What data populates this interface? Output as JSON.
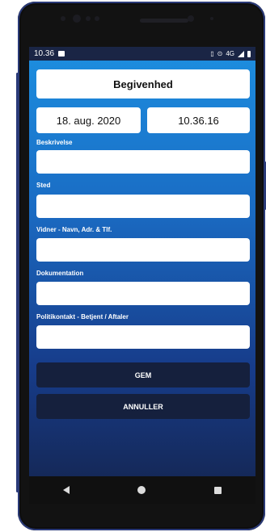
{
  "status_bar": {
    "time": "10.36",
    "network": "4G"
  },
  "header": {
    "title": "Begivenhed"
  },
  "datetime": {
    "date": "18. aug. 2020",
    "time": "10.36.16"
  },
  "fields": [
    {
      "label": "Beskrivelse",
      "value": ""
    },
    {
      "label": "Sted",
      "value": ""
    },
    {
      "label": "Vidner - Navn, Adr. & Tlf.",
      "value": ""
    },
    {
      "label": "Dokumentation",
      "value": ""
    },
    {
      "label": "Politikontakt - Betjent / Aftaler",
      "value": ""
    }
  ],
  "buttons": {
    "save": "GEM",
    "cancel": "ANNULLER"
  },
  "colors": {
    "accent": "#1d8fe0",
    "button": "#15203d"
  }
}
